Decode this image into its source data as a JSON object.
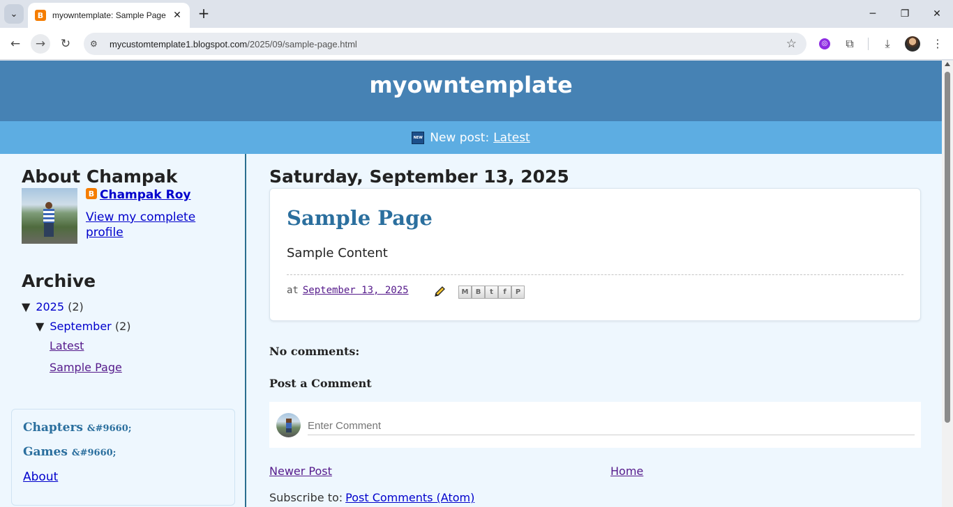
{
  "browser": {
    "tab_title": "myowntemplate: Sample Page",
    "url_host": "mycustomtemplate1.blogspot.com",
    "url_path": "/2025/09/sample-page.html",
    "favicon_letter": "B"
  },
  "blog": {
    "title": "myowntemplate",
    "new_post_label": "New post:",
    "new_post_link": "Latest",
    "new_badge": "NEW"
  },
  "sidebar": {
    "about_title": "About Champak",
    "profile_name": "Champak Roy",
    "profile_link": "View my complete profile",
    "archive_title": "Archive",
    "archive": {
      "year": "2025",
      "year_count": "(2)",
      "month": "September",
      "month_count": "(2)",
      "posts": [
        "Latest",
        "Sample Page"
      ],
      "expanded_glyph": "▼"
    },
    "pages": {
      "chapters": "Chapters",
      "chapters_suffix": "&#9660;",
      "games": "Games",
      "games_suffix": "&#9660;",
      "about": "About"
    }
  },
  "main": {
    "date_header": "Saturday, September 13, 2025",
    "post_title": "Sample Page",
    "post_body": "Sample Content",
    "footer_at": "at",
    "footer_date": "September 13, 2025",
    "share_buttons": [
      "M",
      "B",
      "t",
      "f",
      "P"
    ],
    "comments_title": "No comments:",
    "post_comment_title": "Post a Comment",
    "comment_placeholder": "Enter Comment",
    "newer_post": "Newer Post",
    "home": "Home",
    "subscribe_label": "Subscribe to:",
    "subscribe_link": "Post Comments (Atom)"
  },
  "colors": {
    "header_bg": "#4682b4",
    "newpost_bg": "#5dade2",
    "page_bg": "#eef7fe",
    "post_title": "#2b6f9e"
  }
}
